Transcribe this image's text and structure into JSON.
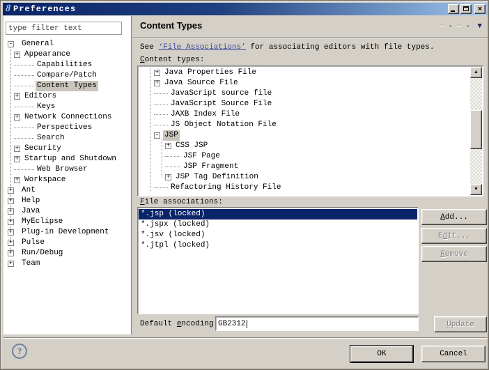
{
  "window": {
    "title": "Preferences"
  },
  "icons": {
    "app": "8",
    "help": "?",
    "back_arrow": "⬅",
    "forward_arrow": "➡",
    "menu_caret": "▾",
    "view_menu": "▼",
    "scroll_up": "▲",
    "scroll_down": "▼"
  },
  "sidebar": {
    "filter_text": "type filter text",
    "items": [
      {
        "label": "General",
        "depth": 0,
        "glyph": "minus",
        "selected": false
      },
      {
        "label": "Appearance",
        "depth": 1,
        "glyph": "plus",
        "selected": false
      },
      {
        "label": "Capabilities",
        "depth": 1,
        "glyph": "leaf",
        "selected": false
      },
      {
        "label": "Compare/Patch",
        "depth": 1,
        "glyph": "leaf",
        "selected": false
      },
      {
        "label": "Content Types",
        "depth": 1,
        "glyph": "leaf",
        "selected": true
      },
      {
        "label": "Editors",
        "depth": 1,
        "glyph": "plus",
        "selected": false
      },
      {
        "label": "Keys",
        "depth": 1,
        "glyph": "leaf",
        "selected": false
      },
      {
        "label": "Network Connections",
        "depth": 1,
        "glyph": "plus",
        "selected": false
      },
      {
        "label": "Perspectives",
        "depth": 1,
        "glyph": "leaf",
        "selected": false
      },
      {
        "label": "Search",
        "depth": 1,
        "glyph": "leaf",
        "selected": false
      },
      {
        "label": "Security",
        "depth": 1,
        "glyph": "plus",
        "selected": false
      },
      {
        "label": "Startup and Shutdown",
        "depth": 1,
        "glyph": "plus",
        "selected": false
      },
      {
        "label": "Web Browser",
        "depth": 1,
        "glyph": "leaf",
        "selected": false
      },
      {
        "label": "Workspace",
        "depth": 1,
        "glyph": "plus",
        "selected": false
      },
      {
        "label": "Ant",
        "depth": 0,
        "glyph": "plus",
        "selected": false
      },
      {
        "label": "Help",
        "depth": 0,
        "glyph": "plus",
        "selected": false
      },
      {
        "label": "Java",
        "depth": 0,
        "glyph": "plus",
        "selected": false
      },
      {
        "label": "MyEclipse",
        "depth": 0,
        "glyph": "plus",
        "selected": false
      },
      {
        "label": "Plug-in Development",
        "depth": 0,
        "glyph": "plus",
        "selected": false
      },
      {
        "label": "Pulse",
        "depth": 0,
        "glyph": "plus",
        "selected": false
      },
      {
        "label": "Run/Debug",
        "depth": 0,
        "glyph": "plus",
        "selected": false
      },
      {
        "label": "Team",
        "depth": 0,
        "glyph": "plus",
        "selected": false
      }
    ]
  },
  "header": {
    "title": "Content Types"
  },
  "intro": {
    "pre": "See ",
    "link_text": "‘File Associations’",
    "post": " for associating editors with file types."
  },
  "content_types": {
    "label": {
      "pre": "",
      "mn": "C",
      "post": "ontent types:"
    },
    "items": [
      {
        "label": "Java Properties File",
        "depth": 1,
        "glyph": "plus",
        "selected": false
      },
      {
        "label": "Java Source File",
        "depth": 1,
        "glyph": "plus",
        "selected": false
      },
      {
        "label": "JavaScript source file",
        "depth": 1,
        "glyph": "leaf",
        "selected": false
      },
      {
        "label": "JavaScript Source File",
        "depth": 1,
        "glyph": "leaf",
        "selected": false
      },
      {
        "label": "JAXB Index File",
        "depth": 1,
        "glyph": "leaf",
        "selected": false
      },
      {
        "label": "JS Object Notation File",
        "depth": 1,
        "glyph": "leaf",
        "selected": false
      },
      {
        "label": "JSP",
        "depth": 1,
        "glyph": "minus",
        "selected": true
      },
      {
        "label": "CSS JSP",
        "depth": 2,
        "glyph": "plus",
        "selected": false
      },
      {
        "label": "JSF Page",
        "depth": 2,
        "glyph": "leaf",
        "selected": false
      },
      {
        "label": "JSP Fragment",
        "depth": 2,
        "glyph": "leaf",
        "selected": false
      },
      {
        "label": "JSP Tag Definition",
        "depth": 2,
        "glyph": "plus",
        "selected": false
      },
      {
        "label": "Refactoring History File",
        "depth": 1,
        "glyph": "leaf",
        "selected": false
      }
    ]
  },
  "file_associations": {
    "label": {
      "pre": "",
      "mn": "F",
      "post": "ile associations:"
    },
    "items": [
      {
        "label": "*.jsp (locked)",
        "selected": true
      },
      {
        "label": "*.jspx (locked)",
        "selected": false
      },
      {
        "label": "*.jsv (locked)",
        "selected": false
      },
      {
        "label": "*.jtpl (locked)",
        "selected": false
      }
    ],
    "buttons": [
      {
        "pre": "",
        "mn": "A",
        "post": "dd...",
        "enabled": true
      },
      {
        "pre": "E",
        "mn": "d",
        "post": "it...",
        "enabled": false
      },
      {
        "pre": "",
        "mn": "R",
        "post": "emove",
        "enabled": false
      }
    ]
  },
  "encoding": {
    "label": {
      "pre": "Default ",
      "mn": "e",
      "post": "ncoding:"
    },
    "value": "GB2312",
    "update_button": {
      "pre": "",
      "mn": "U",
      "post": "pdate",
      "enabled": false
    }
  },
  "footer": {
    "ok_label": "OK",
    "cancel_label": "Cancel"
  },
  "colors": {
    "titlebar_start": "#0a246a",
    "titlebar_end": "#a6c8ee",
    "selection": "#0a246a",
    "inactive_selection": "#c9c5bb",
    "button_face": "#d4d0c8",
    "link": "#3a4a9a"
  }
}
